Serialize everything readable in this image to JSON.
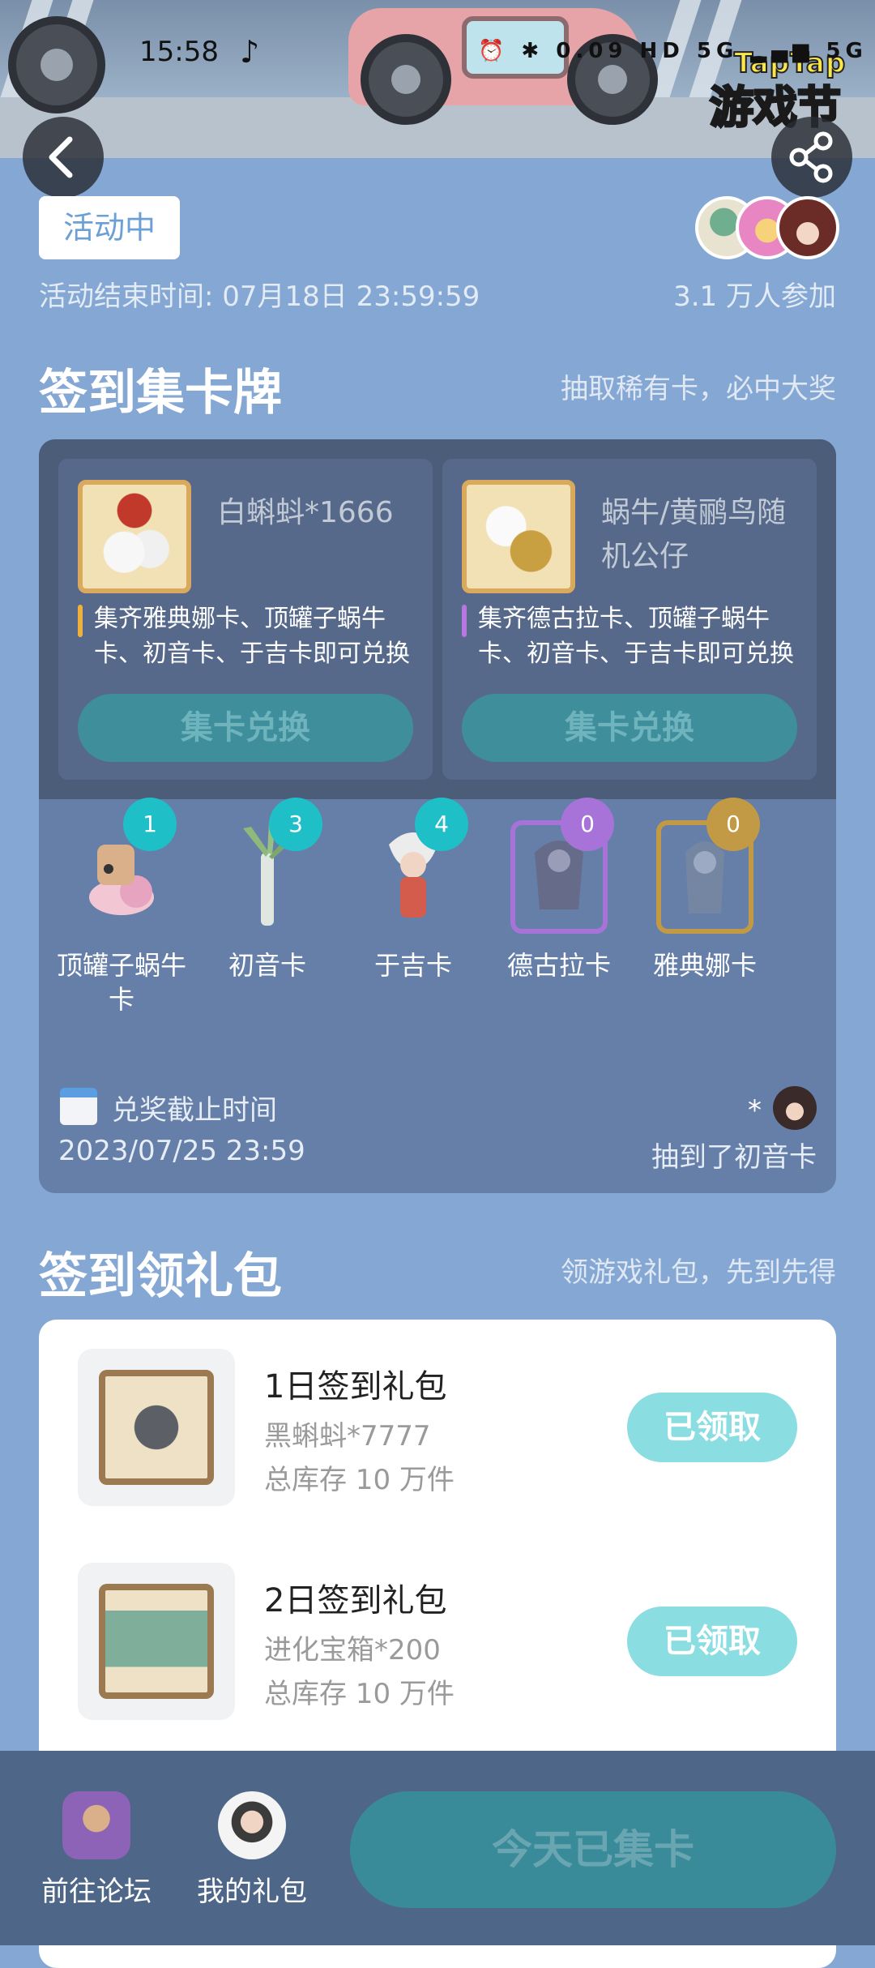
{
  "status_bar": {
    "time": "15:58",
    "icons": "⏰ ✱ 0.09 HD 5G ▂▄▆ 5G"
  },
  "banner": {
    "logo_top": "TapTap",
    "logo_main": "游戏节"
  },
  "activity": {
    "status": "活动中",
    "end_time": "活动结束时间: 07月18日 23:59:59",
    "participants": "3.1 万人参加"
  },
  "sign_in_cards": {
    "title": "签到集卡牌",
    "subtitle": "抽取稀有卡，必中大奖",
    "rewards": [
      {
        "name": "白蝌蚪*1666",
        "desc": "集齐雅典娜卡、顶罐子蜗牛卡、初音卡、于吉卡即可兑换",
        "button": "集卡兑换",
        "accent": "#f0b13c"
      },
      {
        "name": "蜗牛/黄鹂鸟随机公仔",
        "desc": "集齐德古拉卡、顶罐子蜗牛卡、初音卡、于吉卡即可兑换",
        "button": "集卡兑换",
        "accent": "#b678e0"
      }
    ],
    "cards": [
      {
        "count": "1",
        "label": "顶罐子蜗牛卡",
        "badge_color": "#1fbfc7"
      },
      {
        "count": "3",
        "label": "初音卡",
        "badge_color": "#1fbfc7"
      },
      {
        "count": "4",
        "label": "于吉卡",
        "badge_color": "#1fbfc7"
      },
      {
        "count": "0",
        "label": "德古拉卡",
        "badge_color": "#a873d9"
      },
      {
        "count": "0",
        "label": "雅典娜卡",
        "badge_color": "#c29a45"
      }
    ],
    "deadline_label": "兑奖截止时间",
    "deadline_date": "2023/07/25 23:59",
    "drawn_user": "*",
    "drawn_text": "抽到了初音卡"
  },
  "gift_packs": {
    "title": "签到领礼包",
    "subtitle": "领游戏礼包，先到先得",
    "items": [
      {
        "title": "1日签到礼包",
        "item": "黑蝌蚪*7777",
        "stock": "总库存 10 万件",
        "button": "已领取"
      },
      {
        "title": "2日签到礼包",
        "item": "进化宝箱*200",
        "stock": "总库存 10 万件",
        "button": "已领取"
      }
    ]
  },
  "bottom_bar": {
    "forum": "前往论坛",
    "my_gifts": "我的礼包",
    "main_button": "今天已集卡"
  }
}
